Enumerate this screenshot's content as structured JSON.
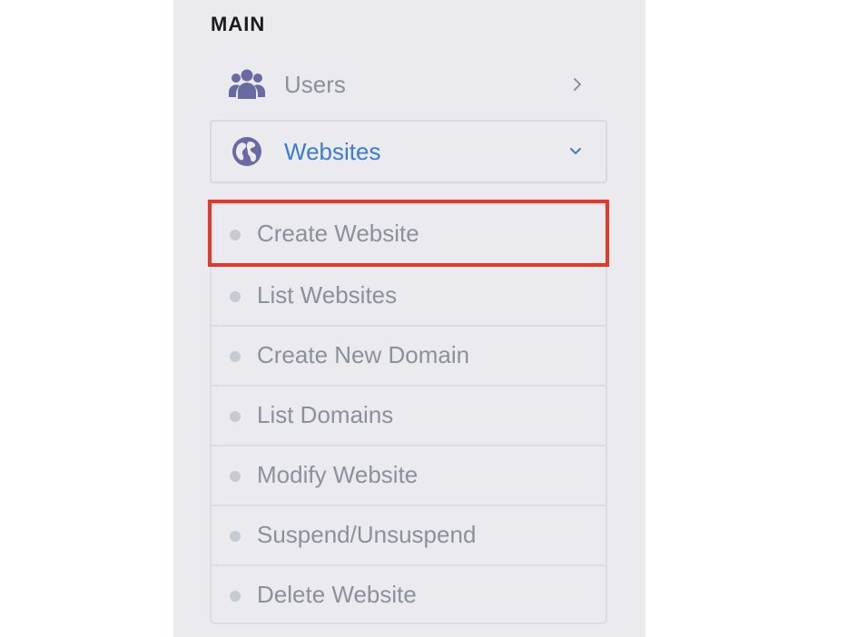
{
  "sidebar": {
    "section_title": "MAIN",
    "nav": [
      {
        "label": "Users",
        "icon": "users-icon",
        "state": "collapsed"
      },
      {
        "label": "Websites",
        "icon": "globe-icon",
        "state": "expanded"
      }
    ],
    "submenu": [
      {
        "label": "Create Website",
        "highlighted": true
      },
      {
        "label": "List Websites"
      },
      {
        "label": "Create New Domain"
      },
      {
        "label": "List Domains"
      },
      {
        "label": "Modify Website"
      },
      {
        "label": "Suspend/Unsuspend"
      },
      {
        "label": "Delete Website"
      }
    ]
  },
  "colors": {
    "sidebar_bg": "#ebebef",
    "icon": "#6a6aa3",
    "active_text": "#3b7bd0",
    "muted_text": "#8b919c",
    "highlight_border": "#e2392b"
  }
}
